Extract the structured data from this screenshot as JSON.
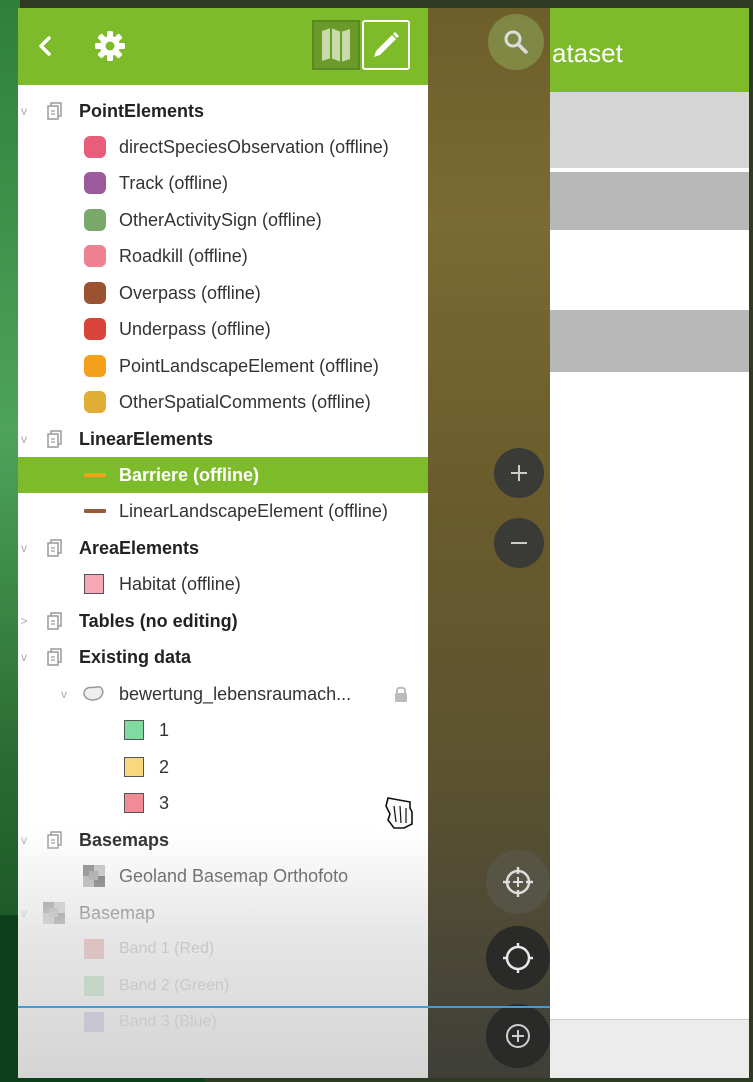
{
  "drawer": {
    "toolbar": {
      "back_icon": "chevron-left-icon",
      "settings_icon": "gear-icon",
      "map_icon": "map-icon",
      "edit_icon": "pencil-icon",
      "color": "#7dbb2a"
    },
    "layers": [
      {
        "label": "PointElements",
        "type": "group"
      },
      {
        "label": "directSpeciesObservation (offline)",
        "symbol": "#e85d7a"
      },
      {
        "label": "Track (offline)",
        "symbol": "#9a5a9c"
      },
      {
        "label": "OtherActivitySign (offline)",
        "symbol": "#7aa86a"
      },
      {
        "label": "Roadkill (offline)",
        "symbol": "#ef8090"
      },
      {
        "label": "Overpass (offline)",
        "symbol": "#9a5230"
      },
      {
        "label": "Underpass (offline)",
        "symbol": "#d8443a"
      },
      {
        "label": "PointLandscapeElement (offline)",
        "symbol": "#f5a01a"
      },
      {
        "label": "OtherSpatialComments (offline)",
        "symbol": "#e0ad35"
      },
      {
        "label": "LinearElements",
        "type": "group"
      },
      {
        "label": "Barriere (offline)",
        "symbol": "#f5a01a",
        "selected": true
      },
      {
        "label": "LinearLandscapeElement (offline)",
        "symbol": "#9a5a3a"
      },
      {
        "label": "AreaElements",
        "type": "group"
      },
      {
        "label": "Habitat (offline)",
        "symbol": "#f5a8b4"
      },
      {
        "label": "Tables (no editing)",
        "type": "group"
      },
      {
        "label": "Existing data",
        "type": "group"
      },
      {
        "label": "bewertung_lebensraumach...",
        "type": "subgroup"
      },
      {
        "label": "1",
        "symbol": "#7fdba0"
      },
      {
        "label": "2",
        "symbol": "#f9d77e"
      },
      {
        "label": "3",
        "symbol": "#f28b96"
      },
      {
        "label": "Basemaps",
        "type": "group"
      },
      {
        "label": "Geoland Basemap Orthofoto",
        "type": "raster"
      },
      {
        "label": "Basemap",
        "type": "raster-group"
      },
      {
        "label": "Band 1 (Red)",
        "symbol": "#cc1111"
      },
      {
        "label": "Band 2 (Green)",
        "symbol": "#11a022"
      },
      {
        "label": "Band 3 (Blue)",
        "symbol": "#1111a0"
      }
    ]
  },
  "right_panel": {
    "title": "ataset",
    "header_color": "#7dbb2a"
  },
  "map_buttons": {
    "search_icon": "search-icon",
    "zoom_in_icon": "plus-icon",
    "zoom_out_icon": "minus-icon",
    "locate_icon": "crosshair-icon",
    "gps_icon": "target-icon",
    "add_icon": "add-icon"
  }
}
